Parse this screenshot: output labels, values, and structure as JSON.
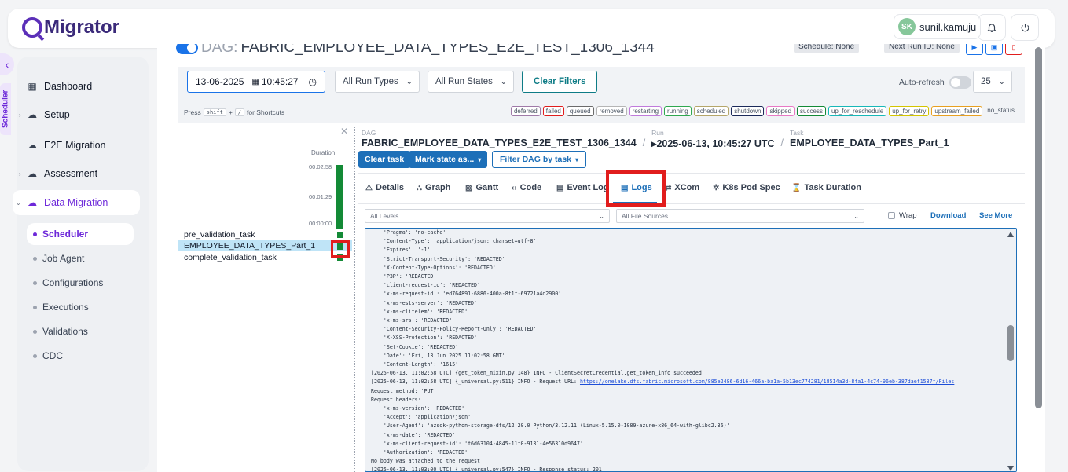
{
  "app": {
    "logo_text": "Migrator"
  },
  "topbar": {
    "user_initials": "SK",
    "username": "sunil.kamuju"
  },
  "sidebar": {
    "vertical_tab": "Scheduler",
    "items": [
      {
        "label": "Dashboard",
        "icon": "grid-icon"
      },
      {
        "label": "Setup",
        "icon": "cloud-gear-icon"
      },
      {
        "label": "E2E Migration",
        "icon": "cloud-gear-icon"
      },
      {
        "label": "Assessment",
        "icon": "cloud-gear-icon"
      },
      {
        "label": "Data Migration",
        "icon": "cloud-gear-icon"
      }
    ],
    "subitems": [
      "Scheduler",
      "Job Agent",
      "Configurations",
      "Executions",
      "Validations",
      "CDC"
    ]
  },
  "dag": {
    "prefix": "DAG:",
    "id": "FABRIC_EMPLOYEE_DATA_TYPES_E2E_TEST_1306_1344",
    "schedule_badge": "Schedule: None",
    "next_run_badge": "Next Run ID: None"
  },
  "filters": {
    "date": "13-06-2025",
    "time": "10:45:27",
    "run_types": "All Run Types",
    "run_states": "All Run States",
    "clear_filters": "Clear Filters",
    "auto_refresh": "Auto-refresh",
    "page_size": "25"
  },
  "legend": {
    "press": "Press",
    "key1": "shift",
    "plus": "+",
    "key2": "/",
    "for_shortcuts": "for Shortcuts",
    "states": [
      "deferred",
      "failed",
      "queued",
      "removed",
      "restarting",
      "running",
      "scheduled",
      "shutdown",
      "skipped",
      "success",
      "up_for_reschedule",
      "up_for_retry",
      "upstream_failed",
      "no_status"
    ],
    "state_colors": [
      "#a07aa8",
      "#e11d1d",
      "#6b6b6b",
      "#b5b5b5",
      "#c07adb",
      "#2fa84f",
      "#b5a66a",
      "#1c2a5a",
      "#e879c5",
      "#138a36",
      "#17b8b8",
      "#d4c400",
      "#e8a020",
      "#ffffff"
    ]
  },
  "grid": {
    "duration_label": "Duration",
    "ticks": [
      "00:02:58",
      "00:01:29",
      "00:00:00"
    ],
    "tasks": [
      "pre_validation_task",
      "EMPLOYEE_DATA_TYPES_Part_1",
      "complete_validation_task"
    ]
  },
  "detail": {
    "crumb_dag_label": "DAG",
    "crumb_dag": "FABRIC_EMPLOYEE_DATA_TYPES_E2E_TEST_1306_1344",
    "crumb_run_label": "Run",
    "crumb_run": "▸2025-06-13, 10:45:27 UTC",
    "crumb_task_label": "Task",
    "crumb_task": "EMPLOYEE_DATA_TYPES_Part_1",
    "clear_task": "Clear task",
    "mark_state": "Mark state as...",
    "filter_dag": "Filter DAG by task",
    "tabs": [
      "Details",
      "Graph",
      "Gantt",
      "Code",
      "Event Log",
      "Logs",
      "XCom",
      "K8s Pod Spec",
      "Task Duration"
    ],
    "levels": "All Levels",
    "file_sources": "All File Sources",
    "wrap": "Wrap",
    "download": "Download",
    "see_more": "See More"
  },
  "log": {
    "lines": [
      "    'Pragma': 'no-cache'",
      "    'Content-Type': 'application/json; charset=utf-8'",
      "    'Expires': '-1'",
      "    'Strict-Transport-Security': 'REDACTED'",
      "    'X-Content-Type-Options': 'REDACTED'",
      "    'P3P': 'REDACTED'",
      "    'client-request-id': 'REDACTED'",
      "    'x-ms-request-id': 'ed764891-6886-400a-8f1f-69721a4d2900'",
      "    'x-ms-ests-server': 'REDACTED'",
      "    'x-ms-clitelem': 'REDACTED'",
      "    'x-ms-srs': 'REDACTED'",
      "    'Content-Security-Policy-Report-Only': 'REDACTED'",
      "    'X-XSS-Protection': 'REDACTED'",
      "    'Set-Cookie': 'REDACTED'",
      "    'Date': 'Fri, 13 Jun 2025 11:02:58 GMT'",
      "    'Content-Length': '1615'",
      "[2025-06-13, 11:02:58 UTC] {get_token_mixin.py:148} INFO - ClientSecretCredential.get_token_info succeeded",
      "[2025-06-13, 11:02:58 UTC] {_universal.py:511} INFO - Request URL: "
    ],
    "request_url": "https://onelake.dfs.fabric.microsoft.com/885e2486-6d16-466a-ba1a-5b13ec774281/18514a3d-8fa1-4c74-96eb-387daef1587f/Files",
    "lines2": [
      "Request method: 'PUT'",
      "Request headers:",
      "    'x-ms-version': 'REDACTED'",
      "    'Accept': 'application/json'",
      "    'User-Agent': 'azsdk-python-storage-dfs/12.20.0 Python/3.12.11 (Linux-5.15.0-1089-azure-x86_64-with-glibc2.36)'",
      "    'x-ms-date': 'REDACTED'",
      "    'x-ms-client-request-id': 'f6d63104-4845-11f0-9131-4e56310d9647'",
      "    'Authorization': 'REDACTED'",
      "No body was attached to the request",
      "[2025-06-13, 11:03:00 UTC] {_universal.py:547} INFO - Response status: 201"
    ]
  }
}
